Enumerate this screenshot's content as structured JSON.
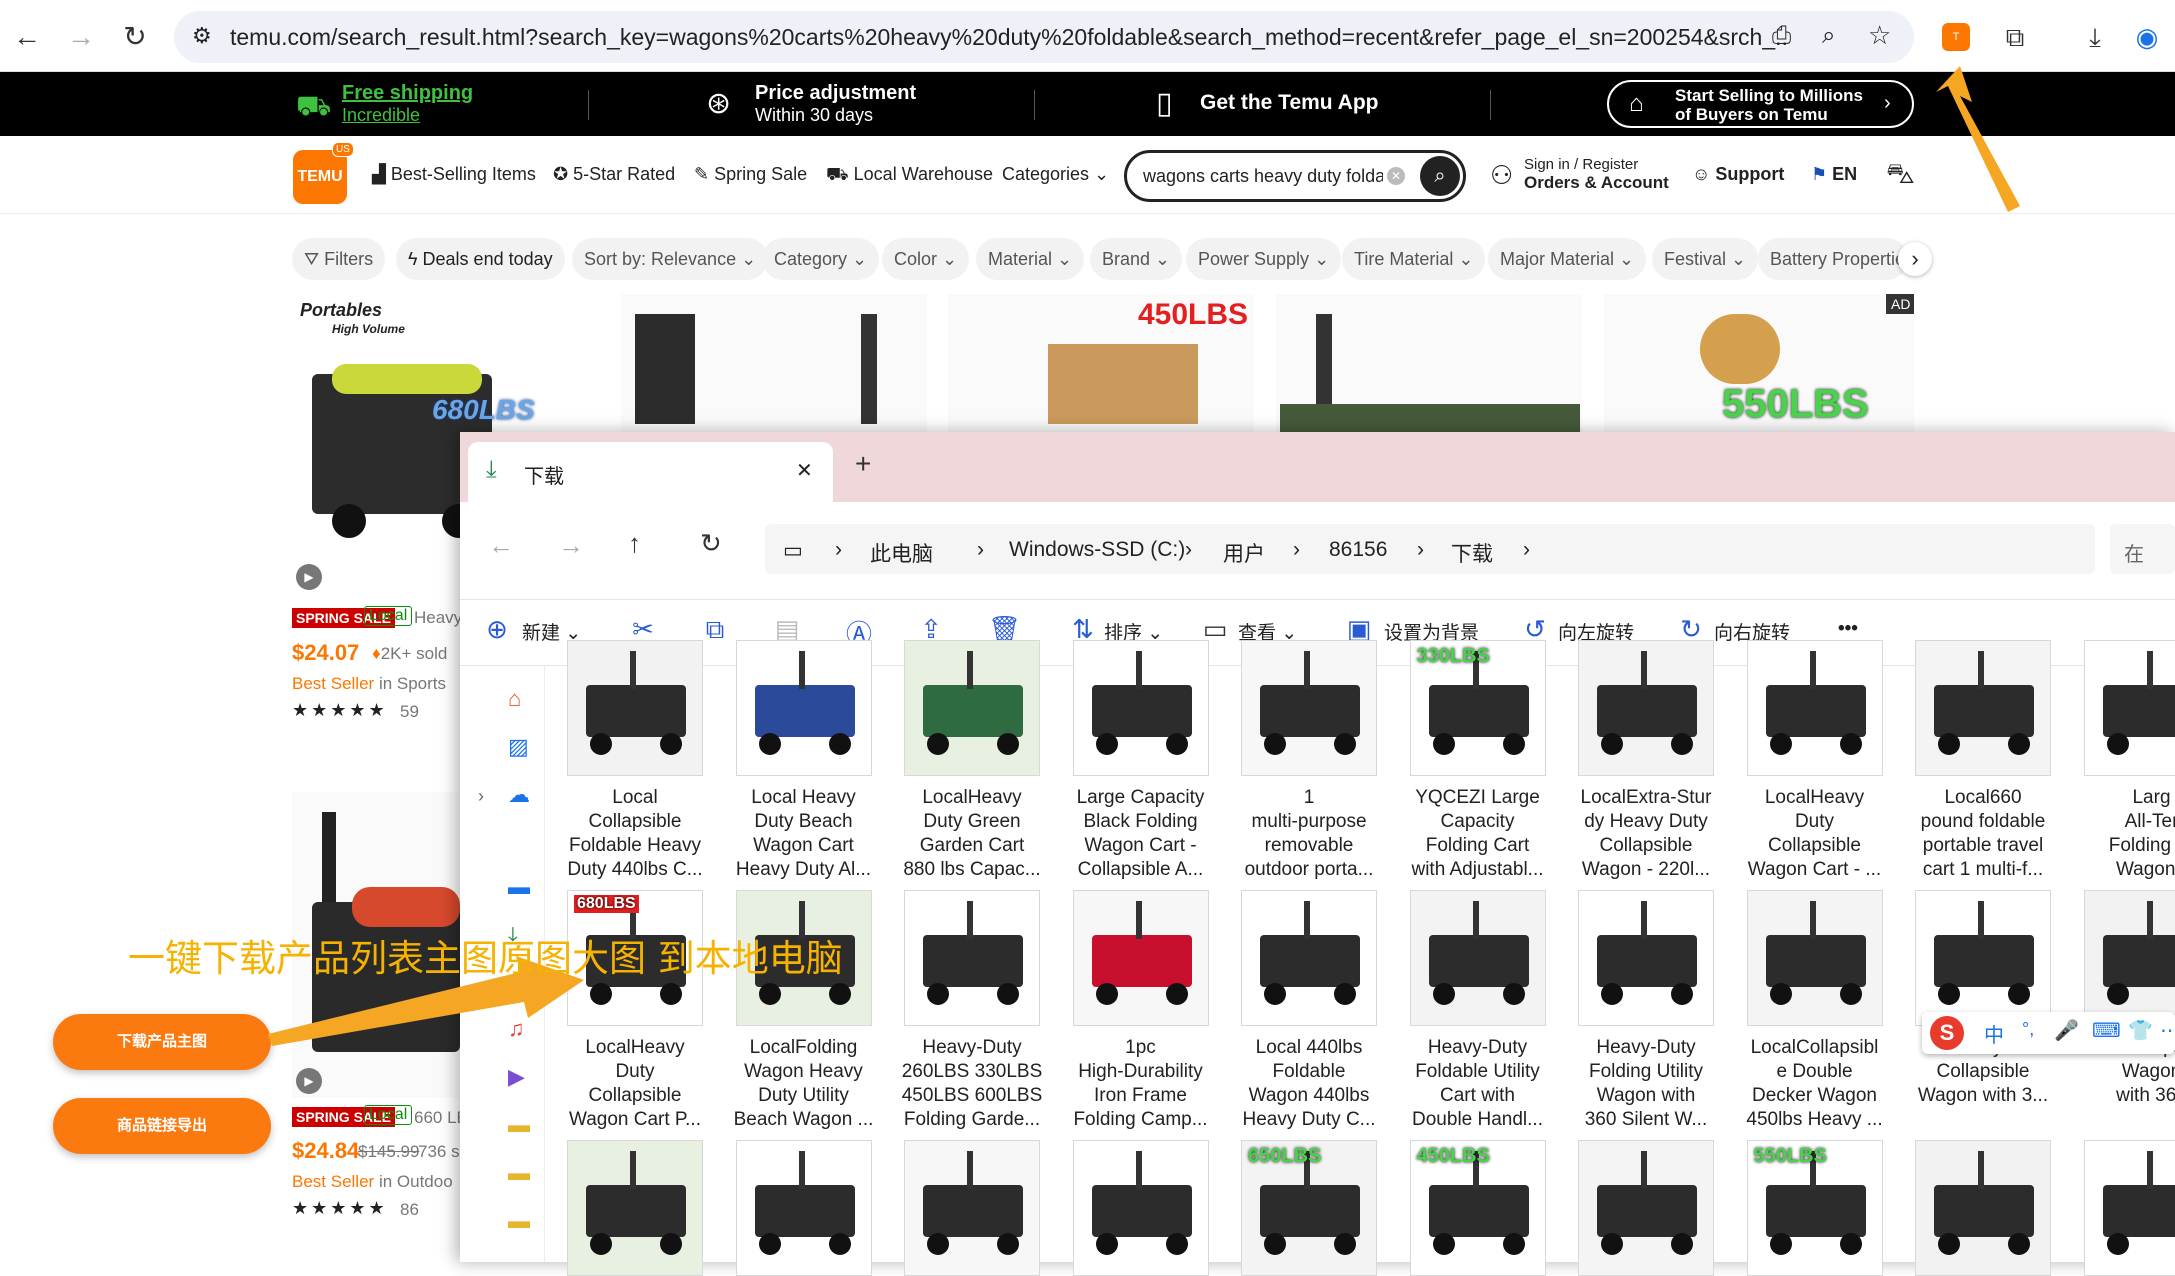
{
  "browser": {
    "url": "temu.com/search_result.html?search_key=wagons%20carts%20heavy%20duty%20foldable&search_method=recent&refer_page_el_sn=200254&srch_...",
    "back": "←",
    "forward": "→",
    "reload": "↻"
  },
  "banner": {
    "shipping_title": "Free shipping",
    "shipping_sub": "Incredible",
    "price_title": "Price adjustment",
    "price_sub": "Within 30 days",
    "app": "Get the Temu App",
    "sell_line1": "Start Selling to Millions",
    "sell_line2": "of Buyers on Temu"
  },
  "nav": {
    "logo": "TEMU",
    "logo_badge": "US",
    "links": [
      "Best-Selling Items",
      "5-Star Rated",
      "Spring Sale",
      "Local Warehouse",
      "Categories"
    ],
    "search_value": "wagons carts heavy duty foldab",
    "sign_in": "Sign in / Register",
    "orders": "Orders & Account",
    "support": "Support",
    "lang": "EN"
  },
  "filters": [
    "Filters",
    "Deals end today",
    "Sort by: Relevance",
    "Category",
    "Color",
    "Material",
    "Brand",
    "Power Supply",
    "Tire Material",
    "Major Material",
    "Festival",
    "Battery Propertie"
  ],
  "products": {
    "p1_img_title": "Portables",
    "p1_img_sub": "High Volume",
    "p1_img_badge": "680LBS",
    "p3_img_badge": "450LBS",
    "p5_img_badge": "550LBS",
    "ad": "AD",
    "p1_sale": "SPRING SALE",
    "p1_local": "Local",
    "p1_title": "Heavy",
    "p1_price": "$24.07",
    "p1_sold": "2K+ sold",
    "p1_best": "Best Seller",
    "p1_best_in": "in Sports",
    "p1_rating": "★★★★★",
    "p1_reviews": "59",
    "p2_sale": "SPRING SALE",
    "p2_local": "Local",
    "p2_title": "660 LB",
    "p2_price": "$24.84",
    "p2_old": "$145.99",
    "p2_sold": "736 s",
    "p2_best": "Best Seller",
    "p2_best_in": "in Outdoo",
    "p2_rating": "★★★★★",
    "p2_reviews": "86"
  },
  "side_buttons": {
    "download": "下载产品主图",
    "export": "商品链接导出"
  },
  "explorer": {
    "tab_title": "下载",
    "tab_close": "✕",
    "tab_add": "+",
    "breadcrumbs": [
      "此电脑",
      "Windows-SSD (C:)",
      "用户",
      "86156",
      "下载"
    ],
    "search_hint": "在",
    "toolbar": {
      "new": "新建",
      "sort": "排序",
      "view": "查看",
      "set_bg": "设置为背景",
      "rotate_left": "向左旋转",
      "rotate_right": "向右旋转",
      "more": "•••"
    },
    "row1": [
      "Local\nCollapsible\nFoldable  Heavy\nDuty 440lbs C...",
      "Local Heavy\nDuty Beach\nWagon Cart\nHeavy Duty Al...",
      "LocalHeavy\nDuty Green\nGarden Cart\n880 lbs Capac...",
      "Large Capacity\nBlack Folding\nWagon Cart -\nCollapsible  A...",
      "1\nmulti-purpose\nremovable\noutdoor porta...",
      "YQCEZI Large\nCapacity\nFolding Cart\nwith Adjustabl...",
      "LocalExtra-Stur\ndy Heavy Duty\nCollapsible\nWagon - 220l...",
      "LocalHeavy\nDuty\nCollapsible\nWagon Cart - ...",
      "Local660\npound foldable\nportable travel\ncart  1 multi-f...",
      "Larg\nAll-Ter\nFolding W\nWagon -"
    ],
    "row2": [
      "LocalHeavy\nDuty\nCollapsible\nWagon Cart P...",
      "LocalFolding\nWagon  Heavy\nDuty Utility\nBeach Wagon ...",
      "Heavy-Duty\n260LBS 330LBS\n450LBS 600LBS\nFolding Garde...",
      "1pc\nHigh-Durability\nIron Frame\nFolding Camp...",
      "Local 440lbs\nFoldable\nWagon  440lbs\nHeavy Duty C...",
      "Heavy-Duty\nFoldable Utility\nCart with\nDouble Handl...",
      "Heavy-Duty\nFolding Utility\nWagon with\n360  Silent W...",
      "LocalCollapsibl\ne Double\nDecker Wagon\n450lbs Heavy ...",
      "Duty\nCollapsible\nWagon with 3...",
      "Collaps\nWagon\nwith 360"
    ],
    "thumb_badges": {
      "r2c1": "680LBS",
      "r1c6": "330LBS",
      "r3c6": "450LBS",
      "r3c8": "550LBS",
      "r3c5": "650LBS"
    }
  },
  "overlay_text": "一键下载产品列表主图原图大图 到本地电脑",
  "ime": [
    "中",
    "°,",
    "🎤",
    "⌨",
    "👕",
    "⋯"
  ],
  "colors": {
    "temu_orange": "#fb7701",
    "arrow": "#f5a623",
    "banner_bg": "#000000",
    "tab_bg": "#f0d7da"
  }
}
